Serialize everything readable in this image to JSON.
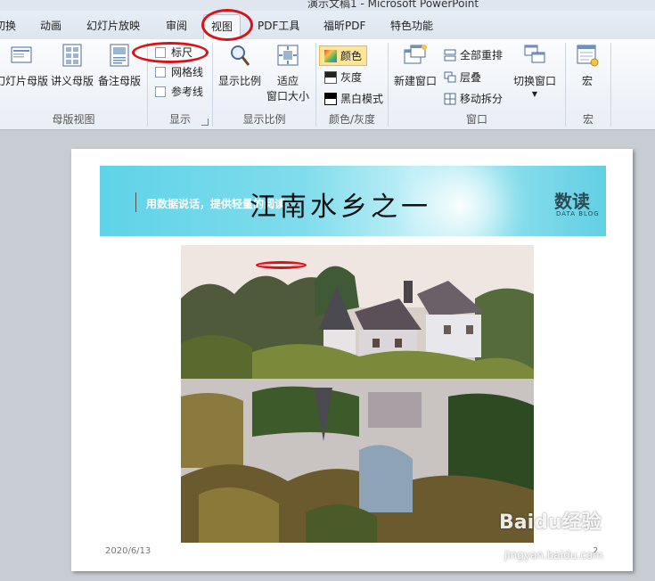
{
  "window": {
    "title": "演示文稿1 - Microsoft PowerPoint"
  },
  "tabs": [
    {
      "label": "切换"
    },
    {
      "label": "动画"
    },
    {
      "label": "幻灯片放映"
    },
    {
      "label": "审阅"
    },
    {
      "label": "视图",
      "active": true
    },
    {
      "label": "PDF工具"
    },
    {
      "label": "福昕PDF"
    },
    {
      "label": "特色功能"
    }
  ],
  "ribbon": {
    "master_views": {
      "label": "母版视图",
      "buttons": [
        {
          "label": "幻灯片母版",
          "icon": "slide-master-icon"
        },
        {
          "label": "讲义母版",
          "icon": "handout-master-icon"
        },
        {
          "label": "备注母版",
          "icon": "notes-master-icon"
        }
      ]
    },
    "show": {
      "label": "显示",
      "checkboxes": [
        {
          "label": "标尺",
          "checked": false
        },
        {
          "label": "网格线",
          "checked": false
        },
        {
          "label": "参考线",
          "checked": false
        }
      ]
    },
    "zoom": {
      "label": "显示比例",
      "buttons": [
        {
          "label": "显示比例",
          "icon": "magnifier-icon"
        },
        {
          "label": "适应\n窗口大小",
          "line1": "适应",
          "line2": "窗口大小",
          "icon": "fit-window-icon"
        }
      ]
    },
    "color": {
      "label": "颜色/灰度",
      "buttons": [
        {
          "label": "颜色",
          "icon": "color-icon",
          "selected": true
        },
        {
          "label": "灰度",
          "icon": "grayscale-icon"
        },
        {
          "label": "黑白模式",
          "icon": "black-white-icon"
        }
      ]
    },
    "window": {
      "label": "窗口",
      "new_window": "新建窗口",
      "arrange_all": "全部重排",
      "cascade": "层叠",
      "move_split": "移动拆分",
      "switch_window": "切换窗口"
    },
    "macros": {
      "label": "宏",
      "button": "宏"
    }
  },
  "slide": {
    "title": "江南水乡之一",
    "banner_slogan": "用数据说话，提供轻量的阅读",
    "brand": "数读",
    "brand_sub": "DATA BLOG",
    "date": "2020/6/13",
    "page_number": "2"
  },
  "watermark": {
    "text": "Baidu经验",
    "sub": "jingyan.baidu.com"
  },
  "colors": {
    "accent_red": "#d8141b",
    "ribbon_bg": "#e9eef5",
    "banner": "#5fd3e8"
  }
}
